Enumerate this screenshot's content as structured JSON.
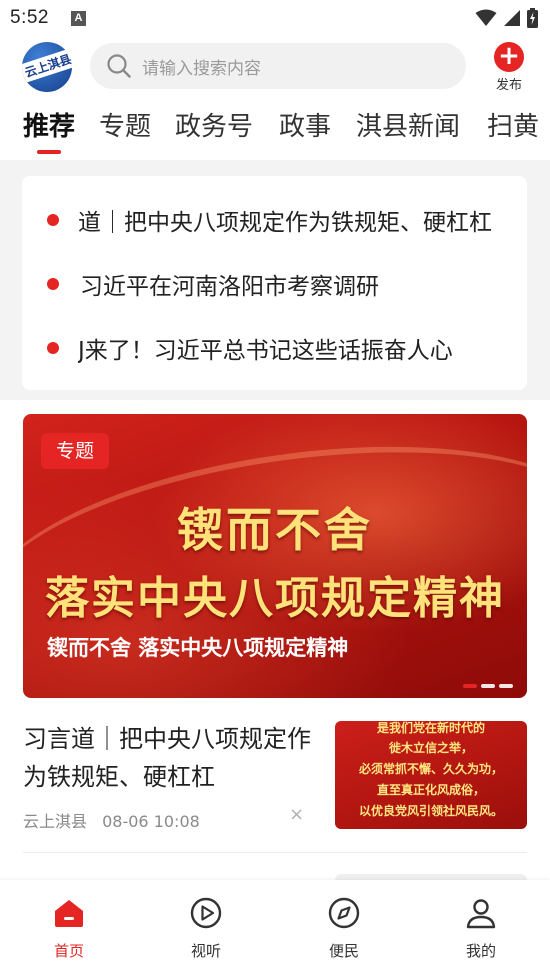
{
  "status_bar": {
    "time": "5:52",
    "notification_letter": "A"
  },
  "header": {
    "logo_text": "云上淇县",
    "search_placeholder": "请输入搜索内容",
    "publish_label": "发布"
  },
  "tabs": [
    {
      "label": "推荐",
      "active": true
    },
    {
      "label": "专题",
      "active": false
    },
    {
      "label": "政务号",
      "active": false
    },
    {
      "label": "政事",
      "active": false
    },
    {
      "label": "淇县新闻",
      "active": false
    },
    {
      "label": "扫黄",
      "active": false
    }
  ],
  "ticker": [
    "道｜把中央八项规定作为铁规矩、硬杠杠",
    "习近平在河南洛阳市考察调研",
    "J来了！习近平总书记这些话振奋人心"
  ],
  "banner": {
    "badge": "专题",
    "headline_line1": "锲而不舍",
    "headline_line2": "落实中央八项规定精神",
    "caption": "锲而不舍 落实中央八项规定精神",
    "slide_count": 3,
    "active_slide": 1
  },
  "article": {
    "title": "习言道｜把中央八项规定作为铁规矩、硬杠杠",
    "source": "云上淇县",
    "time": "08-06 10:08",
    "close_symbol": "×",
    "thumb_lines": [
      "是我们党在新时代的",
      "徙木立信之举，",
      "必须常抓不懈、久久为功，",
      "直至真正化风成俗，",
      "以优良党风引领社风民风。"
    ]
  },
  "bottom_nav": [
    {
      "label": "首页",
      "icon": "home-icon",
      "active": true
    },
    {
      "label": "视听",
      "icon": "play-icon",
      "active": false
    },
    {
      "label": "便民",
      "icon": "compass-icon",
      "active": false
    },
    {
      "label": "我的",
      "icon": "user-icon",
      "active": false
    }
  ],
  "colors": {
    "accent": "#e52523",
    "banner_text": "#ffe27a"
  }
}
